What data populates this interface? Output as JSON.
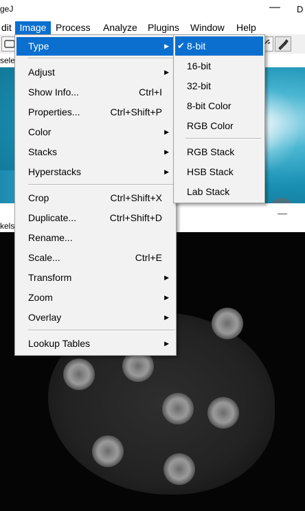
{
  "window": {
    "title": "geJ",
    "minimize_glyph": "—",
    "edge_text": "D"
  },
  "menubar": {
    "items": [
      {
        "label": "dit"
      },
      {
        "label": "Image"
      },
      {
        "label": "Process"
      },
      {
        "label": "Analyze"
      },
      {
        "label": "Plugins"
      },
      {
        "label": "Window"
      },
      {
        "label": "Help"
      }
    ]
  },
  "toolbar": {
    "status_text": "sele",
    "pixels_text": "kels"
  },
  "image_menu": {
    "items": [
      {
        "label": "Type",
        "shortcut": "",
        "submenu": true
      },
      {
        "label": "Adjust",
        "shortcut": "",
        "submenu": true
      },
      {
        "label": "Show Info...",
        "shortcut": "Ctrl+I",
        "submenu": false
      },
      {
        "label": "Properties...",
        "shortcut": "Ctrl+Shift+P",
        "submenu": false
      },
      {
        "label": "Color",
        "shortcut": "",
        "submenu": true
      },
      {
        "label": "Stacks",
        "shortcut": "",
        "submenu": true
      },
      {
        "label": "Hyperstacks",
        "shortcut": "",
        "submenu": true
      },
      {
        "label": "Crop",
        "shortcut": "Ctrl+Shift+X",
        "submenu": false
      },
      {
        "label": "Duplicate...",
        "shortcut": "Ctrl+Shift+D",
        "submenu": false
      },
      {
        "label": "Rename...",
        "shortcut": "",
        "submenu": false
      },
      {
        "label": "Scale...",
        "shortcut": "Ctrl+E",
        "submenu": false
      },
      {
        "label": "Transform",
        "shortcut": "",
        "submenu": true
      },
      {
        "label": "Zoom",
        "shortcut": "",
        "submenu": true
      },
      {
        "label": "Overlay",
        "shortcut": "",
        "submenu": true
      },
      {
        "label": "Lookup Tables",
        "shortcut": "",
        "submenu": true
      }
    ]
  },
  "type_submenu": {
    "items": [
      {
        "label": "8-bit",
        "checked": true
      },
      {
        "label": "16-bit",
        "checked": false
      },
      {
        "label": "32-bit",
        "checked": false
      },
      {
        "label": "8-bit Color",
        "checked": false
      },
      {
        "label": "RGB Color",
        "checked": false
      },
      {
        "label": "RGB Stack",
        "checked": false
      },
      {
        "label": "HSB Stack",
        "checked": false
      },
      {
        "label": "Lab Stack",
        "checked": false
      }
    ]
  },
  "glyphs": {
    "check": "✔",
    "arrow": "▶"
  },
  "colors": {
    "highlight": "#0a6fcf",
    "menu_bg": "#f2f2f2",
    "image_bottom": "#050505"
  },
  "icons": [
    "rectangle-tool-icon",
    "wand-tool-icon",
    "picker-tool-icon"
  ]
}
